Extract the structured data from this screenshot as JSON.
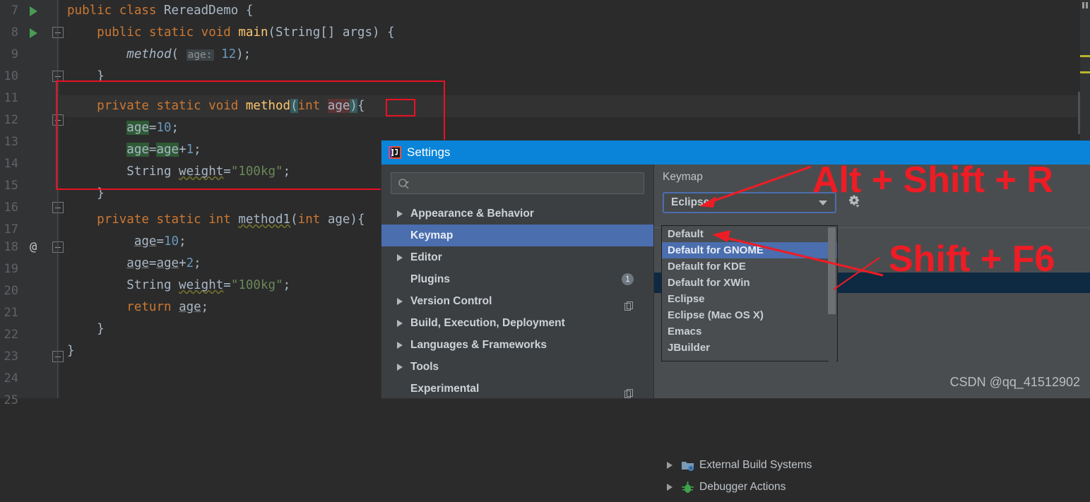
{
  "editor": {
    "lines": [
      {
        "n": "7",
        "run": true,
        "fold": "none",
        "at": false
      },
      {
        "n": "8",
        "run": true,
        "fold": "open",
        "at": false
      },
      {
        "n": "9",
        "run": false,
        "fold": "none",
        "at": false
      },
      {
        "n": "10",
        "run": false,
        "fold": "end",
        "at": false
      },
      {
        "n": "11",
        "run": false,
        "fold": "none",
        "at": false
      },
      {
        "n": "12",
        "run": false,
        "fold": "open",
        "at": false
      },
      {
        "n": "13",
        "run": false,
        "fold": "none",
        "at": false
      },
      {
        "n": "14",
        "run": false,
        "fold": "none",
        "at": false
      },
      {
        "n": "15",
        "run": false,
        "fold": "none",
        "at": false
      },
      {
        "n": "16",
        "run": false,
        "fold": "end",
        "at": false
      },
      {
        "n": "17",
        "run": false,
        "fold": "none",
        "at": false
      },
      {
        "n": "18",
        "run": false,
        "fold": "open",
        "at": true
      },
      {
        "n": "19",
        "run": false,
        "fold": "none",
        "at": false
      },
      {
        "n": "20",
        "run": false,
        "fold": "none",
        "at": false
      },
      {
        "n": "21",
        "run": false,
        "fold": "none",
        "at": false
      },
      {
        "n": "22",
        "run": false,
        "fold": "none",
        "at": false
      },
      {
        "n": "23",
        "run": false,
        "fold": "end",
        "at": false
      },
      {
        "n": "24",
        "run": false,
        "fold": "none",
        "at": false
      },
      {
        "n": "25",
        "run": false,
        "fold": "none",
        "at": false
      }
    ],
    "source": [
      "public class RereadDemo {",
      "    public static void main(String[] args) {",
      "        method( age: 12);",
      "    }",
      "",
      "    private static void method(int age){",
      "        age=10;",
      "        age=age+1;",
      "        String weight=\"100kg\";",
      "    }",
      "",
      "    private static int method1(int age){",
      "        age=10;",
      "        age=age+2;",
      "        String weight=\"100kg\";",
      "        return age;",
      "    }",
      "}",
      ""
    ],
    "current_line": "12",
    "rename_target": "age",
    "inlay_hint": "age:"
  },
  "dialog": {
    "title": "Settings",
    "search": {
      "value": "",
      "placeholder": ""
    },
    "sidebar": [
      {
        "label": "Appearance & Behavior",
        "arrow": true,
        "selected": false,
        "badge": null,
        "copy": false
      },
      {
        "label": "Keymap",
        "arrow": false,
        "selected": true,
        "badge": null,
        "copy": false
      },
      {
        "label": "Editor",
        "arrow": true,
        "selected": false,
        "badge": null,
        "copy": false
      },
      {
        "label": "Plugins",
        "arrow": false,
        "selected": false,
        "badge": "1",
        "copy": false
      },
      {
        "label": "Version Control",
        "arrow": true,
        "selected": false,
        "badge": null,
        "copy": true
      },
      {
        "label": "Build, Execution, Deployment",
        "arrow": true,
        "selected": false,
        "badge": null,
        "copy": false
      },
      {
        "label": "Languages & Frameworks",
        "arrow": true,
        "selected": false,
        "badge": null,
        "copy": false
      },
      {
        "label": "Tools",
        "arrow": true,
        "selected": false,
        "badge": null,
        "copy": false
      },
      {
        "label": "Experimental",
        "arrow": false,
        "selected": false,
        "badge": null,
        "copy": true
      }
    ],
    "right": {
      "heading": "Keymap",
      "combo_value": "Eclipse",
      "gear_icon": "gear-icon",
      "dropdown_options": [
        {
          "label": "Default",
          "selected": false
        },
        {
          "label": "Default for GNOME",
          "selected": true
        },
        {
          "label": "Default for KDE",
          "selected": false
        },
        {
          "label": "Default for XWin",
          "selected": false
        },
        {
          "label": "Eclipse",
          "selected": false
        },
        {
          "label": "Eclipse (Mac OS X)",
          "selected": false
        },
        {
          "label": "Emacs",
          "selected": false
        },
        {
          "label": "JBuilder",
          "selected": false
        }
      ],
      "action_tree": [
        {
          "label": "External Build Systems",
          "icon": "folder-gear-icon"
        },
        {
          "label": "Debugger Actions",
          "icon": "bug-icon"
        }
      ]
    }
  },
  "annotations": {
    "shortcut_rename": "Alt + Shift + R",
    "shortcut_refactor": "Shift + F6",
    "accent_red": "#ee1c25"
  },
  "watermark": "CSDN @qq_41512902"
}
